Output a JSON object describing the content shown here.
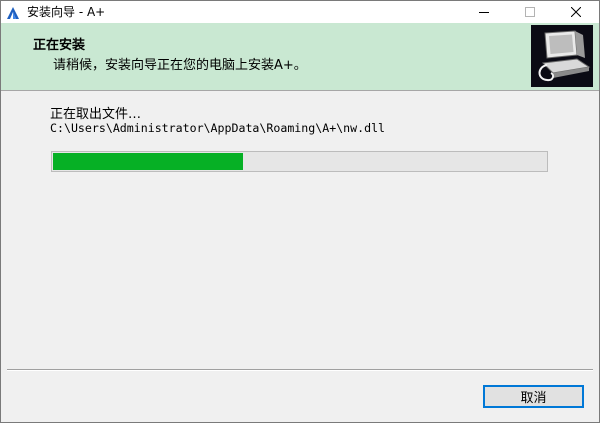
{
  "window": {
    "title": "安装向导 - A+",
    "controls": {
      "minimize_icon": "minimize-icon",
      "maximize_icon": "maximize-icon",
      "close_icon": "close-icon"
    }
  },
  "header": {
    "title": "正在安装",
    "subtitle": "请稍候，安装向导正在您的电脑上安装A+。",
    "image_icon": "installer-computer-icon",
    "background_color": "#c9e8d2"
  },
  "body": {
    "status_text": "正在取出文件…",
    "file_path": "C:\\Users\\Administrator\\AppData\\Roaming\\A+\\nw.dll",
    "progress": {
      "fraction": 0.385,
      "fill_color": "#06b025"
    }
  },
  "footer": {
    "cancel_label": "取消"
  }
}
